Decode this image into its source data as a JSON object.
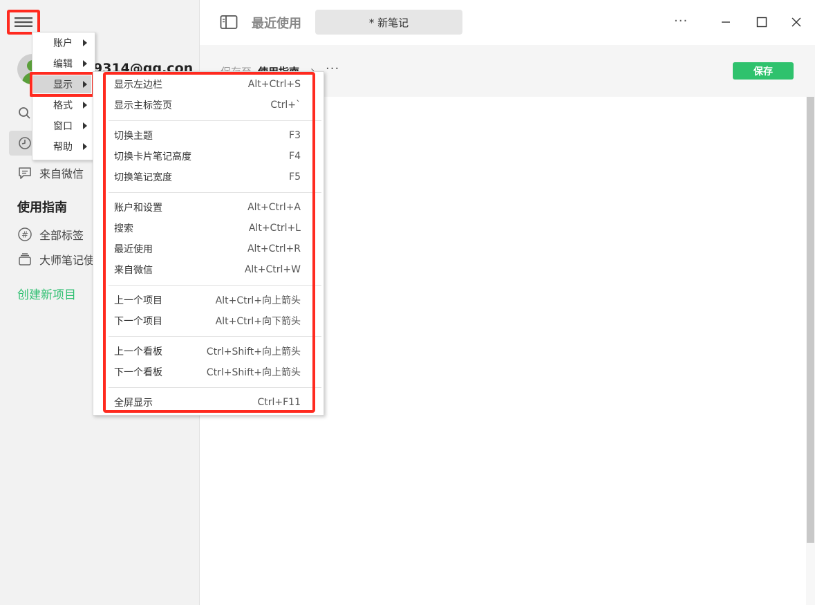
{
  "sidebar": {
    "user_email": "9314@qq.con",
    "nav": {
      "wechat": "来自微信"
    },
    "section_title": "使用指南",
    "items": {
      "all_tags": "全部标签",
      "notebook": "大师笔记使"
    },
    "create_project": "创建新项目"
  },
  "header": {
    "recent_heading": "最近使用",
    "note_tab": "* 新笔记",
    "more": "···"
  },
  "save_bar": {
    "save_to_label": "保存至",
    "notebook": "使用指南",
    "arrow": "›",
    "more": "···",
    "save_button": "保存"
  },
  "app_menu": {
    "items": [
      "账户",
      "编辑",
      "显示",
      "格式",
      "窗口",
      "帮助"
    ]
  },
  "display_menu": {
    "groups": [
      [
        {
          "label": "显示左边栏",
          "shortcut": "Alt+Ctrl+S"
        },
        {
          "label": "显示主标签页",
          "shortcut": "Ctrl+`"
        }
      ],
      [
        {
          "label": "切换主题",
          "shortcut": "F3"
        },
        {
          "label": "切换卡片笔记高度",
          "shortcut": "F4"
        },
        {
          "label": "切换笔记宽度",
          "shortcut": "F5"
        }
      ],
      [
        {
          "label": "账户和设置",
          "shortcut": "Alt+Ctrl+A"
        },
        {
          "label": "搜索",
          "shortcut": "Alt+Ctrl+L"
        },
        {
          "label": "最近使用",
          "shortcut": "Alt+Ctrl+R"
        },
        {
          "label": "来自微信",
          "shortcut": "Alt+Ctrl+W"
        }
      ],
      [
        {
          "label": "上一个项目",
          "shortcut": "Alt+Ctrl+向上箭头"
        },
        {
          "label": "下一个项目",
          "shortcut": "Alt+Ctrl+向下箭头"
        }
      ],
      [
        {
          "label": "上一个看板",
          "shortcut": "Ctrl+Shift+向上箭头"
        },
        {
          "label": "下一个看板",
          "shortcut": "Ctrl+Shift+向上箭头"
        }
      ],
      [
        {
          "label": "全屏显示",
          "shortcut": "Ctrl+F11"
        }
      ]
    ]
  },
  "colors": {
    "accent_green": "#2fc26d",
    "highlight_red": "#ff2a1f",
    "sidebar_bg": "#f2f2f2"
  },
  "icons": {
    "hamburger": "hamburger-menu-icon",
    "search": "search-icon",
    "recent": "clock-icon",
    "wechat": "chat-bubble-icon",
    "tags": "hash-icon",
    "notebook": "notebook-stack-icon",
    "panel_toggle": "sidebar-toggle-icon",
    "minimize": "minimize-icon",
    "maximize": "maximize-icon",
    "close": "close-icon"
  }
}
